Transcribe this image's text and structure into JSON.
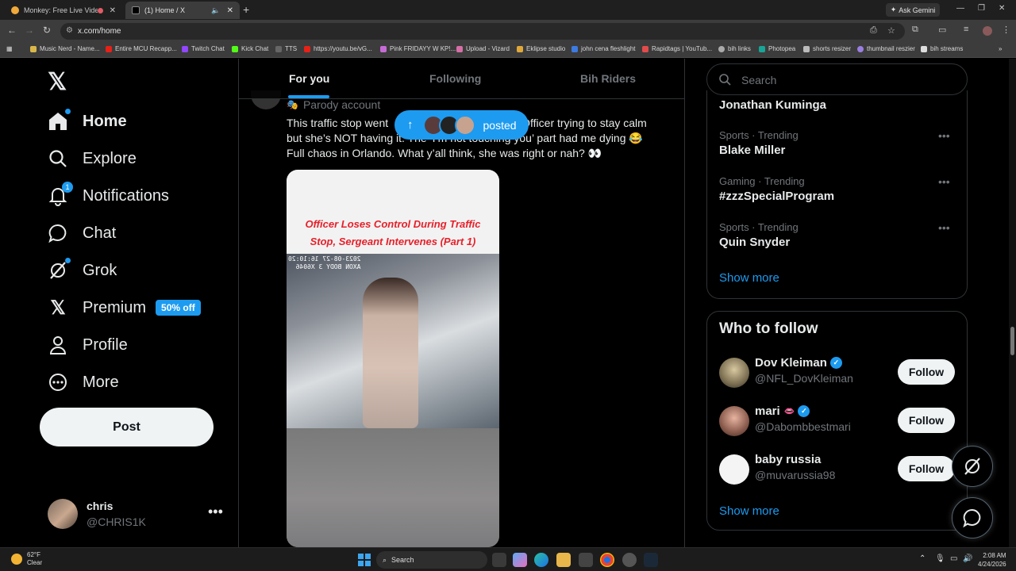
{
  "browser": {
    "tabs": [
      {
        "title": "Monkey: Free Live Video Ch",
        "active": false
      },
      {
        "title": "(1) Home / X",
        "active": true
      }
    ],
    "new_tab_symbol": "+",
    "ask_gemini": "Ask Gemini",
    "url": "x.com/home",
    "bookmarks": [
      "Music Nerd - Name...",
      "Entire MCU Recapp...",
      "Twitch Chat",
      "Kick Chat",
      "TTS",
      "https://youtu.be/vG...",
      "Pink FRIDAYY W KP!...",
      "Upload - Vizard",
      "Eklipse studio",
      "john cena fleshlight",
      "Rapidtags | YouTub...",
      "bih links",
      "Photopea",
      "shorts resizer",
      "thumbnail reszier",
      "bih streams"
    ]
  },
  "nav": {
    "home": "Home",
    "explore": "Explore",
    "notifications": "Notifications",
    "notifications_badge": "1",
    "chat": "Chat",
    "grok": "Grok",
    "premium": "Premium",
    "premium_promo": "50% off",
    "profile": "Profile",
    "more": "More",
    "post": "Post"
  },
  "account": {
    "name": "chris",
    "handle": "@CHRIS1K"
  },
  "feed": {
    "tabs": [
      "For you",
      "Following",
      "Bih Riders"
    ],
    "active_tab": "For you",
    "posted_pill": "posted",
    "tweet": {
      "label": "Parody account",
      "text": "This traffic stop went … Officer trying to stay calm but she’s NOT having it. The ‘I’m not touching you’ part had me dying 😂 Full chaos in Orlando. What y’all think, she was right or nah? 👀",
      "text_line1": "This traffic stop went",
      "text_line1b": "Officer trying to stay calm",
      "text_line2": "but she’s NOT having it. The ‘I’m not touching you’ part had me dying 😂",
      "text_line3": "Full chaos in Orlando. What y’all think, she was right or nah? 👀",
      "media_caption": "Officer Loses Control During Traffic Stop, Sergeant Intervenes (Part 1)",
      "media_timestamp": "2023-08-27 16:10:20\nAXON BODY 3 X6046"
    }
  },
  "sidebar": {
    "search_placeholder": "Search",
    "trends": [
      {
        "meta": "",
        "name": "Jonathan Kuminga"
      },
      {
        "meta": "Sports · Trending",
        "name": "Blake Miller"
      },
      {
        "meta": "Gaming · Trending",
        "name": "#zzzSpecialProgram"
      },
      {
        "meta": "Sports · Trending",
        "name": "Quin Snyder"
      }
    ],
    "trends_show_more": "Show more",
    "who_to_follow_title": "Who to follow",
    "follow": [
      {
        "name": "Dov Kleiman",
        "handle": "@NFL_DovKleiman",
        "button": "Follow"
      },
      {
        "name": "mari",
        "handle": "@Dabombbestmari",
        "button": "Follow"
      },
      {
        "name": "baby russia",
        "handle": "@muvarussia98",
        "button": "Follow"
      }
    ],
    "follow_show_more": "Show more"
  },
  "taskbar": {
    "temp": "62°F",
    "condition": "Clear",
    "search": "Search",
    "time": "2:08 AM",
    "date": "4/24/2026"
  },
  "colors": {
    "accent": "#1d9bf0",
    "background": "#000000",
    "text": "#e7e9ea",
    "muted": "#71767b"
  }
}
